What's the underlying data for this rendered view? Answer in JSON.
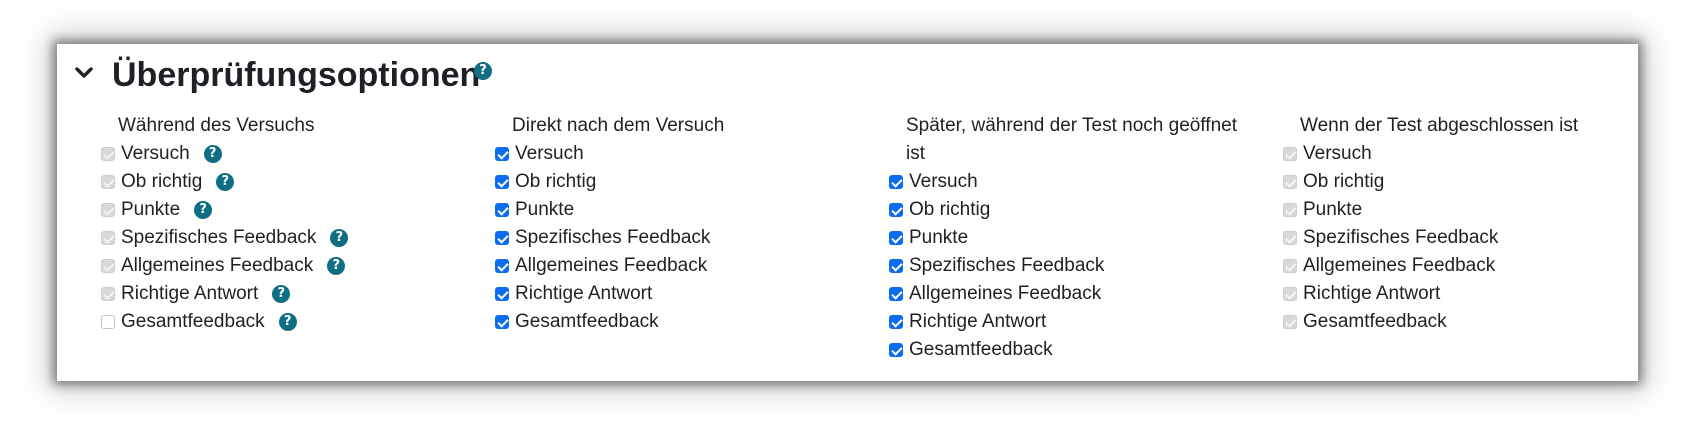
{
  "section": {
    "title": "Überprüfungsoptionen",
    "help_glyph": "?",
    "chevron_icon": "chevron-down-icon"
  },
  "columns": [
    {
      "heading": "Während des Versuchs",
      "items": [
        {
          "label": "Versuch",
          "state": "disabled-checked",
          "help": true
        },
        {
          "label": "Ob richtig",
          "state": "disabled-checked",
          "help": true
        },
        {
          "label": "Punkte",
          "state": "disabled-checked",
          "help": true
        },
        {
          "label": "Spezifisches Feedback",
          "state": "disabled-checked",
          "help": true
        },
        {
          "label": "Allgemeines Feedback",
          "state": "disabled-checked",
          "help": true
        },
        {
          "label": "Richtige Antwort",
          "state": "disabled-checked",
          "help": true
        },
        {
          "label": "Gesamtfeedback",
          "state": "unchecked",
          "help": true
        }
      ]
    },
    {
      "heading": "Direkt nach dem Versuch",
      "items": [
        {
          "label": "Versuch",
          "state": "checked",
          "help": false
        },
        {
          "label": "Ob richtig",
          "state": "checked",
          "help": false
        },
        {
          "label": "Punkte",
          "state": "checked",
          "help": false
        },
        {
          "label": "Spezifisches Feedback",
          "state": "checked",
          "help": false
        },
        {
          "label": "Allgemeines Feedback",
          "state": "checked",
          "help": false
        },
        {
          "label": "Richtige Antwort",
          "state": "checked",
          "help": false
        },
        {
          "label": "Gesamtfeedback",
          "state": "checked",
          "help": false
        }
      ]
    },
    {
      "heading": "Später, während der Test noch geöffnet ist",
      "items": [
        {
          "label": "Versuch",
          "state": "checked",
          "help": false
        },
        {
          "label": "Ob richtig",
          "state": "checked",
          "help": false
        },
        {
          "label": "Punkte",
          "state": "checked",
          "help": false
        },
        {
          "label": "Spezifisches Feedback",
          "state": "checked",
          "help": false
        },
        {
          "label": "Allgemeines Feedback",
          "state": "checked",
          "help": false
        },
        {
          "label": "Richtige Antwort",
          "state": "checked",
          "help": false
        },
        {
          "label": "Gesamtfeedback",
          "state": "checked",
          "help": false
        }
      ]
    },
    {
      "heading": "Wenn der Test abgeschlossen ist",
      "items": [
        {
          "label": "Versuch",
          "state": "disabled-checked",
          "help": false
        },
        {
          "label": "Ob richtig",
          "state": "disabled-checked",
          "help": false
        },
        {
          "label": "Punkte",
          "state": "disabled-checked",
          "help": false
        },
        {
          "label": "Spezifisches Feedback",
          "state": "disabled-checked",
          "help": false
        },
        {
          "label": "Allgemeines Feedback",
          "state": "disabled-checked",
          "help": false
        },
        {
          "label": "Richtige Antwort",
          "state": "disabled-checked",
          "help": false
        },
        {
          "label": "Gesamtfeedback",
          "state": "disabled-checked",
          "help": false
        }
      ]
    }
  ],
  "colors": {
    "checkbox_checked": "#0b6cf0",
    "checkbox_disabled": "#d9d9d9",
    "help_icon": "#0f6e84",
    "text": "#1d2125"
  }
}
